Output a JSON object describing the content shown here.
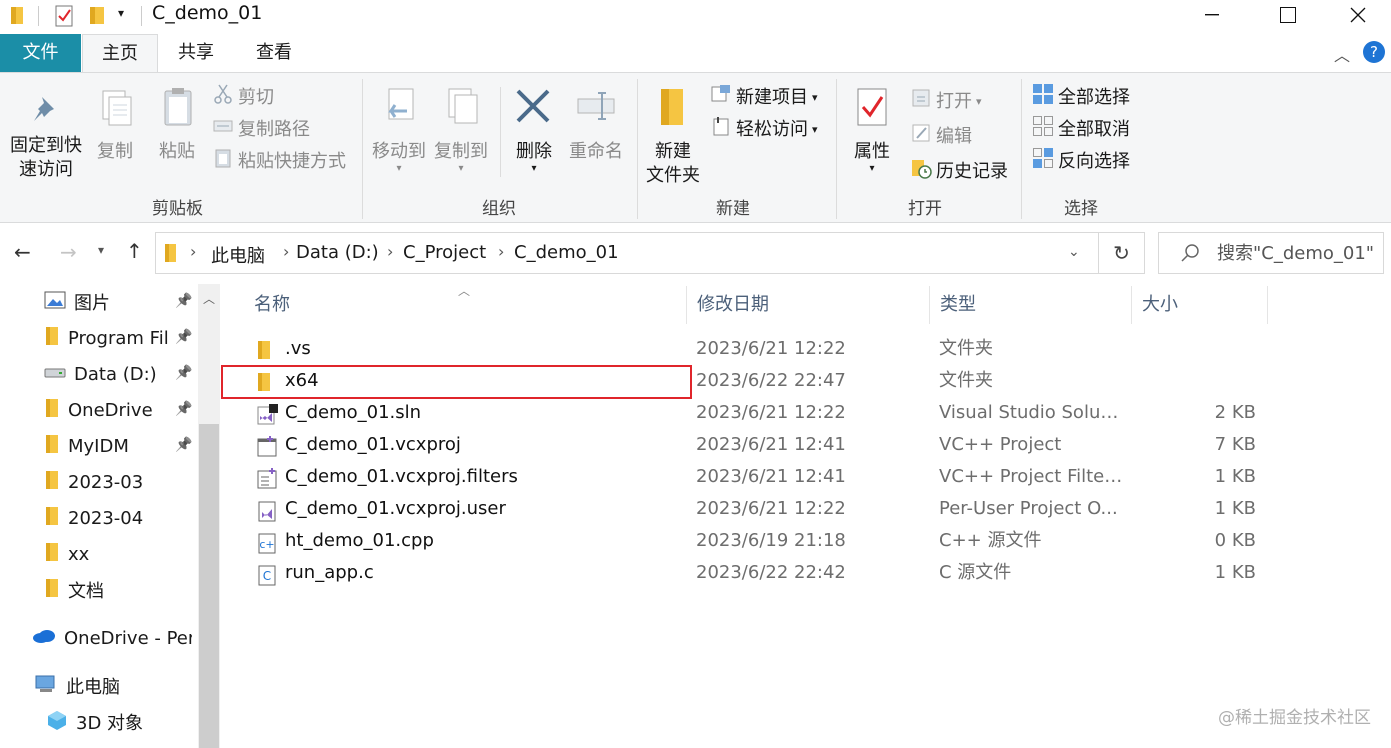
{
  "window": {
    "title": "C_demo_01"
  },
  "ribbon_tabs": {
    "file": "文件",
    "home": "主页",
    "share": "共享",
    "view": "查看"
  },
  "ribbon": {
    "clipboard": {
      "pin_line1": "固定到快",
      "pin_line2": "速访问",
      "copy": "复制",
      "paste": "粘贴",
      "cut": "剪切",
      "copy_path": "复制路径",
      "paste_shortcut": "粘贴快捷方式",
      "label": "剪贴板"
    },
    "organize": {
      "move_to": "移动到",
      "copy_to": "复制到",
      "delete": "删除",
      "rename": "重命名",
      "label": "组织"
    },
    "new": {
      "new_folder_line1": "新建",
      "new_folder_line2": "文件夹",
      "new_item": "新建项目",
      "easy_access": "轻松访问",
      "label": "新建"
    },
    "open": {
      "properties": "属性",
      "open": "打开",
      "edit": "编辑",
      "history": "历史记录",
      "label": "打开"
    },
    "select": {
      "select_all": "全部选择",
      "select_none": "全部取消",
      "invert": "反向选择",
      "label": "选择"
    }
  },
  "address": {
    "crumbs": [
      "此电脑",
      "Data (D:)",
      "C_Project",
      "C_demo_01"
    ],
    "search_placeholder": "搜索\"C_demo_01\""
  },
  "nav": {
    "items": [
      {
        "label": "图片",
        "icon": "pictures-icon",
        "pinned": true
      },
      {
        "label": "Program Fil",
        "icon": "folder-icon",
        "pinned": true
      },
      {
        "label": "Data (D:)",
        "icon": "drive-icon",
        "pinned": true
      },
      {
        "label": "OneDrive",
        "icon": "folder-icon",
        "pinned": true
      },
      {
        "label": "MyIDM",
        "icon": "folder-icon",
        "pinned": true
      },
      {
        "label": "2023-03",
        "icon": "folder-icon",
        "pinned": false
      },
      {
        "label": "2023-04",
        "icon": "folder-icon",
        "pinned": false
      },
      {
        "label": "xx",
        "icon": "folder-icon",
        "pinned": false
      },
      {
        "label": "文档",
        "icon": "folder-icon",
        "pinned": false
      }
    ],
    "onedrive_personal": "OneDrive - Pers",
    "this_pc": "此电脑",
    "objects3d": "3D 对象"
  },
  "columns": {
    "name": "名称",
    "date": "修改日期",
    "type": "类型",
    "size": "大小"
  },
  "files": [
    {
      "name": ".vs",
      "date": "2023/6/21 12:22",
      "type": "文件夹",
      "size": "",
      "icon": "folder-icon"
    },
    {
      "name": "x64",
      "date": "2023/6/22 22:47",
      "type": "文件夹",
      "size": "",
      "icon": "folder-icon"
    },
    {
      "name": "C_demo_01.sln",
      "date": "2023/6/21 12:22",
      "type": "Visual Studio Soluti...",
      "size": "2 KB",
      "icon": "vs-solution-icon"
    },
    {
      "name": "C_demo_01.vcxproj",
      "date": "2023/6/21 12:41",
      "type": "VC++ Project",
      "size": "7 KB",
      "icon": "vcxproj-icon"
    },
    {
      "name": "C_demo_01.vcxproj.filters",
      "date": "2023/6/21 12:41",
      "type": "VC++ Project Filter...",
      "size": "1 KB",
      "icon": "filters-icon"
    },
    {
      "name": "C_demo_01.vcxproj.user",
      "date": "2023/6/21 12:22",
      "type": "Per-User Project O...",
      "size": "1 KB",
      "icon": "user-file-icon"
    },
    {
      "name": "ht_demo_01.cpp",
      "date": "2023/6/19 21:18",
      "type": "C++ 源文件",
      "size": "0 KB",
      "icon": "cpp-file-icon"
    },
    {
      "name": "run_app.c",
      "date": "2023/6/22 22:42",
      "type": "C 源文件",
      "size": "1 KB",
      "icon": "c-file-icon"
    }
  ],
  "highlighted_row": "x64",
  "watermark": "@稀土掘金技术社区",
  "colors": {
    "file_tab": "#1b8ea7",
    "highlight": "#e0252b",
    "folder": "#f5c542"
  }
}
